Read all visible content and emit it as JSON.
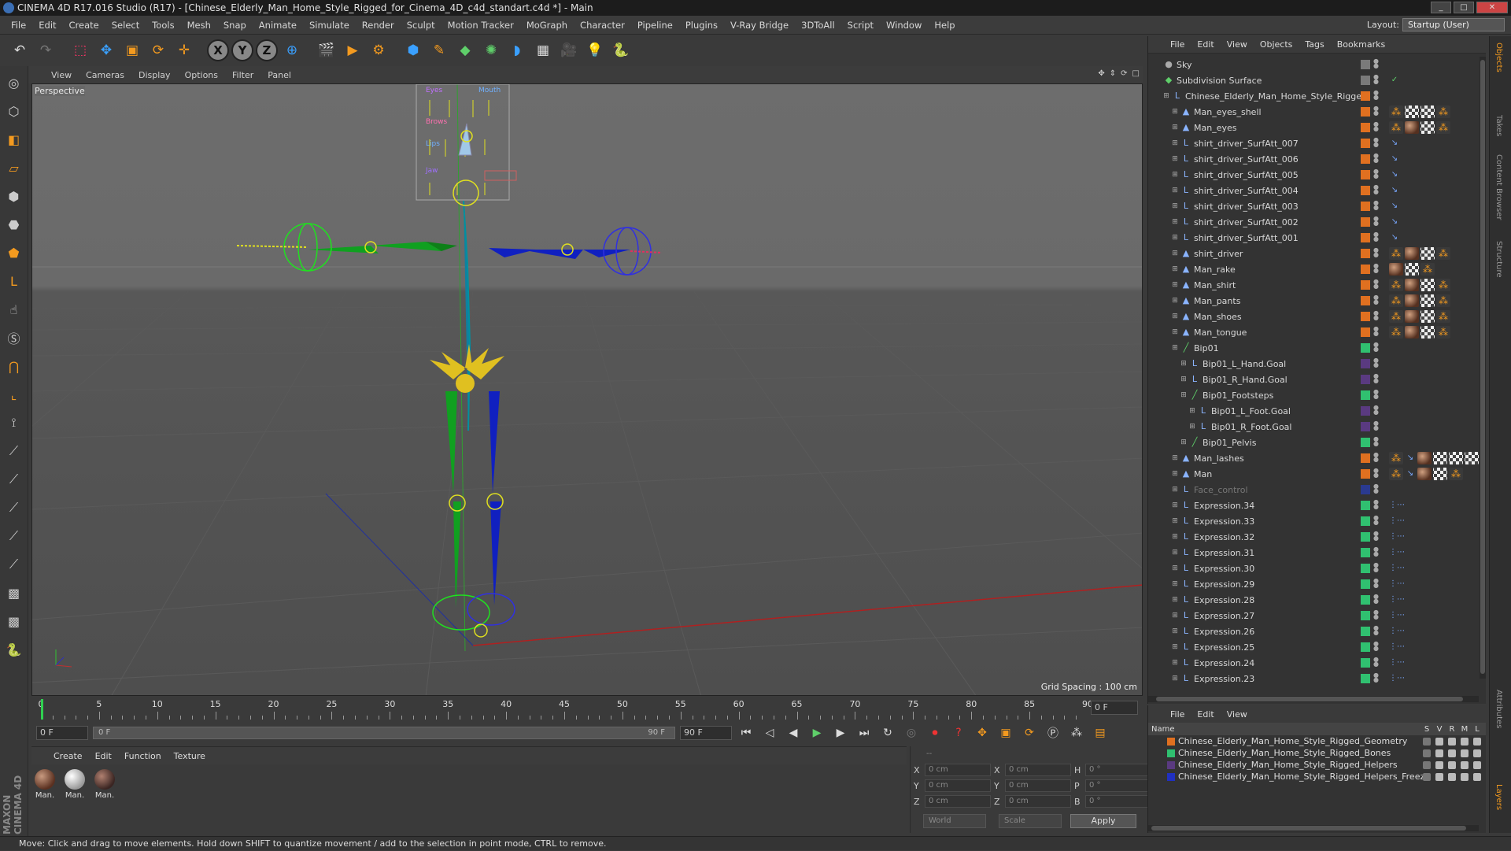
{
  "window": {
    "title": "CINEMA 4D R17.016 Studio (R17) - [Chinese_Elderly_Man_Home_Style_Rigged_for_Cinema_4D_c4d_standart.c4d *] - Main"
  },
  "menubar": [
    "File",
    "Edit",
    "Create",
    "Select",
    "Tools",
    "Mesh",
    "Snap",
    "Animate",
    "Simulate",
    "Render",
    "Sculpt",
    "Motion Tracker",
    "MoGraph",
    "Character",
    "Pipeline",
    "Plugins",
    "V-Ray Bridge",
    "3DToAll",
    "Script",
    "Window",
    "Help"
  ],
  "layout": {
    "label": "Layout:",
    "value": "Startup (User)"
  },
  "toolbar": {
    "icons": [
      "undo-icon",
      "redo-icon",
      "live-selection-icon",
      "move-icon",
      "scale-icon",
      "rotate-icon",
      "move-plus-icon",
      "x-axis-icon",
      "y-axis-icon",
      "z-axis-icon",
      "world-coords-icon",
      "render-view-icon",
      "render-picture-viewer-icon",
      "edit-render-settings-icon",
      "cube-icon",
      "pen-spline-icon",
      "subdivision-icon",
      "cloner-icon",
      "deformer-icon",
      "floor-icon",
      "camera-icon",
      "light-icon",
      "python-icon"
    ]
  },
  "viewport_menu": [
    "View",
    "Cameras",
    "Display",
    "Options",
    "Filter",
    "Panel"
  ],
  "viewport": {
    "label": "Perspective",
    "grid_spacing": "Grid Spacing : 100 cm",
    "controller_labels": [
      "Eyes",
      "Mouth",
      "Brows",
      "Lips",
      "Jaw"
    ]
  },
  "timeline": {
    "ticks": [
      "0",
      "5",
      "10",
      "15",
      "20",
      "25",
      "30",
      "35",
      "40",
      "45",
      "50",
      "55",
      "60",
      "65",
      "70",
      "75",
      "80",
      "85",
      "90"
    ],
    "current_frame": "0 F",
    "start_field": "0 F",
    "slider_start": "0 F",
    "slider_end": "90 F",
    "end_field": "90 F"
  },
  "material_menu": [
    "Create",
    "Edit",
    "Function",
    "Texture"
  ],
  "materials": [
    {
      "label": "Man.",
      "kind": "skin"
    },
    {
      "label": "Man.",
      "kind": "white"
    },
    {
      "label": "Man.",
      "kind": "dark"
    }
  ],
  "coords": {
    "header": "--",
    "rows": [
      {
        "a": "X",
        "av": "0 cm",
        "b": "X",
        "bv": "0 cm",
        "c": "H",
        "cv": "0 °"
      },
      {
        "a": "Y",
        "av": "0 cm",
        "b": "Y",
        "bv": "0 cm",
        "c": "P",
        "cv": "0 °"
      },
      {
        "a": "Z",
        "av": "0 cm",
        "b": "Z",
        "bv": "0 cm",
        "c": "B",
        "cv": "0 °"
      }
    ],
    "space": "World",
    "mode": "Scale",
    "apply": "Apply"
  },
  "status": "Move: Click and drag to move elements. Hold down SHIFT to quantize movement / add to the selection in point mode, CTRL to remove.",
  "brand": "MAXON CINEMA 4D",
  "objects_menu": [
    "File",
    "Edit",
    "View",
    "Objects",
    "Tags",
    "Bookmarks"
  ],
  "objects": [
    {
      "name": "Sky",
      "depth": 0,
      "icon": "sky-icon",
      "color": "#7a7a7a",
      "tags": []
    },
    {
      "name": "Subdivision Surface",
      "depth": 0,
      "icon": "subdivision-icon",
      "color": "#7a7a7a",
      "tags": [
        "check"
      ]
    },
    {
      "name": "Chinese_Elderly_Man_Home_Style_Rigged",
      "depth": 1,
      "icon": "null-icon",
      "color": "#e07020",
      "tags": []
    },
    {
      "name": "Man_eyes_shell",
      "depth": 2,
      "icon": "poly-icon",
      "color": "#e07020",
      "tags": [
        "ora",
        "chk",
        "chk",
        "ora"
      ]
    },
    {
      "name": "Man_eyes",
      "depth": 2,
      "icon": "poly-icon",
      "color": "#e07020",
      "tags": [
        "ora",
        "mat",
        "chk",
        "ora"
      ]
    },
    {
      "name": "shirt_driver_SurfAtt_007",
      "depth": 2,
      "icon": "null-icon",
      "color": "#e07020",
      "tags": [
        "blu"
      ]
    },
    {
      "name": "shirt_driver_SurfAtt_006",
      "depth": 2,
      "icon": "null-icon",
      "color": "#e07020",
      "tags": [
        "blu"
      ]
    },
    {
      "name": "shirt_driver_SurfAtt_005",
      "depth": 2,
      "icon": "null-icon",
      "color": "#e07020",
      "tags": [
        "blu"
      ]
    },
    {
      "name": "shirt_driver_SurfAtt_004",
      "depth": 2,
      "icon": "null-icon",
      "color": "#e07020",
      "tags": [
        "blu"
      ]
    },
    {
      "name": "shirt_driver_SurfAtt_003",
      "depth": 2,
      "icon": "null-icon",
      "color": "#e07020",
      "tags": [
        "blu"
      ]
    },
    {
      "name": "shirt_driver_SurfAtt_002",
      "depth": 2,
      "icon": "null-icon",
      "color": "#e07020",
      "tags": [
        "blu"
      ]
    },
    {
      "name": "shirt_driver_SurfAtt_001",
      "depth": 2,
      "icon": "null-icon",
      "color": "#e07020",
      "tags": [
        "blu"
      ]
    },
    {
      "name": "shirt_driver",
      "depth": 2,
      "icon": "poly-icon",
      "color": "#e07020",
      "tags": [
        "ora",
        "mat",
        "chk",
        "ora"
      ]
    },
    {
      "name": "Man_rake",
      "depth": 2,
      "icon": "poly-icon",
      "color": "#e07020",
      "tags": [
        "mat",
        "chk",
        "ora"
      ]
    },
    {
      "name": "Man_shirt",
      "depth": 2,
      "icon": "poly-icon",
      "color": "#e07020",
      "tags": [
        "ora",
        "mat",
        "chk",
        "ora"
      ]
    },
    {
      "name": "Man_pants",
      "depth": 2,
      "icon": "poly-icon",
      "color": "#e07020",
      "tags": [
        "ora",
        "mat",
        "chk",
        "ora"
      ]
    },
    {
      "name": "Man_shoes",
      "depth": 2,
      "icon": "poly-icon",
      "color": "#e07020",
      "tags": [
        "ora",
        "mat",
        "chk",
        "ora"
      ]
    },
    {
      "name": "Man_tongue",
      "depth": 2,
      "icon": "poly-icon",
      "color": "#e07020",
      "tags": [
        "ora",
        "mat",
        "chk",
        "ora"
      ]
    },
    {
      "name": "Bip01",
      "depth": 2,
      "icon": "bone-icon",
      "color": "#30c070",
      "tags": []
    },
    {
      "name": "Bip01_L_Hand.Goal",
      "depth": 3,
      "icon": "null-icon",
      "color": "#5a3a80",
      "tags": []
    },
    {
      "name": "Bip01_R_Hand.Goal",
      "depth": 3,
      "icon": "null-icon",
      "color": "#5a3a80",
      "tags": []
    },
    {
      "name": "Bip01_Footsteps",
      "depth": 3,
      "icon": "bone-icon",
      "color": "#30c070",
      "tags": []
    },
    {
      "name": "Bip01_L_Foot.Goal",
      "depth": 4,
      "icon": "null-icon",
      "color": "#5a3a80",
      "tags": []
    },
    {
      "name": "Bip01_R_Foot.Goal",
      "depth": 4,
      "icon": "null-icon",
      "color": "#5a3a80",
      "tags": []
    },
    {
      "name": "Bip01_Pelvis",
      "depth": 3,
      "icon": "bone-icon",
      "color": "#30c070",
      "tags": []
    },
    {
      "name": "Man_lashes",
      "depth": 2,
      "icon": "poly-icon",
      "color": "#e07020",
      "tags": [
        "ora",
        "blu",
        "mat",
        "chk",
        "chk",
        "chk"
      ]
    },
    {
      "name": "Man",
      "depth": 2,
      "icon": "poly-icon",
      "color": "#e07020",
      "tags": [
        "ora",
        "blu",
        "mat",
        "chk",
        "ora"
      ]
    },
    {
      "name": "Face_control",
      "depth": 2,
      "icon": "null-icon",
      "color": "#2a3a90",
      "tags": [],
      "dim": true
    },
    {
      "name": "Expression.34",
      "depth": 2,
      "icon": "null-icon",
      "color": "#30c070",
      "tags": [
        "xp"
      ]
    },
    {
      "name": "Expression.33",
      "depth": 2,
      "icon": "null-icon",
      "color": "#30c070",
      "tags": [
        "xp"
      ]
    },
    {
      "name": "Expression.32",
      "depth": 2,
      "icon": "null-icon",
      "color": "#30c070",
      "tags": [
        "xp"
      ]
    },
    {
      "name": "Expression.31",
      "depth": 2,
      "icon": "null-icon",
      "color": "#30c070",
      "tags": [
        "xp"
      ]
    },
    {
      "name": "Expression.30",
      "depth": 2,
      "icon": "null-icon",
      "color": "#30c070",
      "tags": [
        "xp"
      ]
    },
    {
      "name": "Expression.29",
      "depth": 2,
      "icon": "null-icon",
      "color": "#30c070",
      "tags": [
        "xp"
      ]
    },
    {
      "name": "Expression.28",
      "depth": 2,
      "icon": "null-icon",
      "color": "#30c070",
      "tags": [
        "xp"
      ]
    },
    {
      "name": "Expression.27",
      "depth": 2,
      "icon": "null-icon",
      "color": "#30c070",
      "tags": [
        "xp"
      ]
    },
    {
      "name": "Expression.26",
      "depth": 2,
      "icon": "null-icon",
      "color": "#30c070",
      "tags": [
        "xp"
      ]
    },
    {
      "name": "Expression.25",
      "depth": 2,
      "icon": "null-icon",
      "color": "#30c070",
      "tags": [
        "xp"
      ]
    },
    {
      "name": "Expression.24",
      "depth": 2,
      "icon": "null-icon",
      "color": "#30c070",
      "tags": [
        "xp"
      ]
    },
    {
      "name": "Expression.23",
      "depth": 2,
      "icon": "null-icon",
      "color": "#30c070",
      "tags": [
        "xp"
      ]
    }
  ],
  "layers_menu": [
    "File",
    "Edit",
    "View"
  ],
  "layers_header": {
    "name": "Name",
    "cols": [
      "S",
      "V",
      "R",
      "M",
      "L"
    ]
  },
  "layers": [
    {
      "name": "Chinese_Elderly_Man_Home_Style_Rigged_Geometry",
      "color": "#e07020"
    },
    {
      "name": "Chinese_Elderly_Man_Home_Style_Rigged_Bones",
      "color": "#30c070"
    },
    {
      "name": "Chinese_Elderly_Man_Home_Style_Rigged_Helpers",
      "color": "#5a3a80"
    },
    {
      "name": "Chinese_Elderly_Man_Home_Style_Rigged_Helpers_Freeze",
      "color": "#2030c0"
    }
  ],
  "side_tabs": [
    "Objects",
    "Takes",
    "Content Browser",
    "Structure",
    "Attributes",
    "Layers"
  ]
}
